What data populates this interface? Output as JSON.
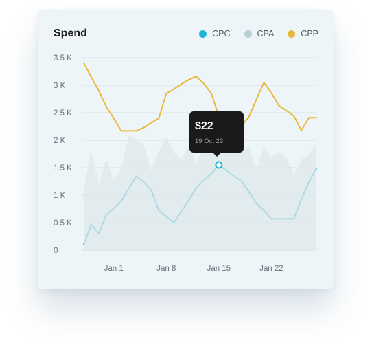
{
  "chart_data": {
    "type": "line",
    "title": "Spend",
    "xlabel": "",
    "ylabel": "",
    "y_ticks": [
      "3.5 K",
      "3 K",
      "2.5 K",
      "2 K",
      "1.5 K",
      "1 K",
      "0.5 K",
      "0"
    ],
    "ylim": [
      0,
      3500
    ],
    "x_ticks": [
      {
        "label": "Jan 1",
        "x": 4
      },
      {
        "label": "Jan 8",
        "x": 11
      },
      {
        "label": "Jan 15",
        "x": 18
      },
      {
        "label": "Jan 22",
        "x": 25
      }
    ],
    "x": [
      0,
      1,
      2,
      3,
      4,
      5,
      6,
      7,
      8,
      9,
      10,
      11,
      12,
      13,
      14,
      15,
      16,
      17,
      18,
      19,
      20,
      21,
      22,
      23,
      24,
      25,
      26,
      27,
      28,
      29,
      30,
      31
    ],
    "series": [
      {
        "name": "CPC",
        "color": "#1fb4d8",
        "values": [
          100,
          470,
          300,
          640,
          760,
          890,
          1120,
          1340,
          1240,
          1090,
          720,
          610,
          500,
          700,
          910,
          1130,
          1270,
          1390,
          1550,
          1450,
          1350,
          1260,
          1060,
          850,
          720,
          570,
          570,
          570,
          570,
          920,
          1240,
          1490
        ]
      },
      {
        "name": "CPA",
        "color": "#b8d0d3",
        "values": [
          1110,
          1790,
          1200,
          1650,
          1270,
          1480,
          2100,
          2000,
          1920,
          1440,
          1810,
          2050,
          1780,
          1640,
          1890,
          1580,
          1890,
          1750,
          1820,
          1790,
          1800,
          1760,
          1900,
          1460,
          1880,
          1690,
          1790,
          1700,
          1350,
          1650,
          1730,
          1950
        ]
      },
      {
        "name": "CPP",
        "color": "#e8b83a",
        "values": [
          3410,
          3150,
          2900,
          2610,
          2400,
          2170,
          2170,
          2170,
          2230,
          2320,
          2400,
          2850,
          2930,
          3020,
          3100,
          3160,
          3030,
          2850,
          2440,
          2190,
          2100,
          2260,
          2420,
          2740,
          3050,
          2860,
          2630,
          2540,
          2440,
          2180,
          2410,
          2410
        ]
      }
    ],
    "tooltip": {
      "value": "$22",
      "date": "19 Oct 23",
      "series": "CPC",
      "x": 18
    },
    "grid": true,
    "legend_position": "top-right"
  }
}
